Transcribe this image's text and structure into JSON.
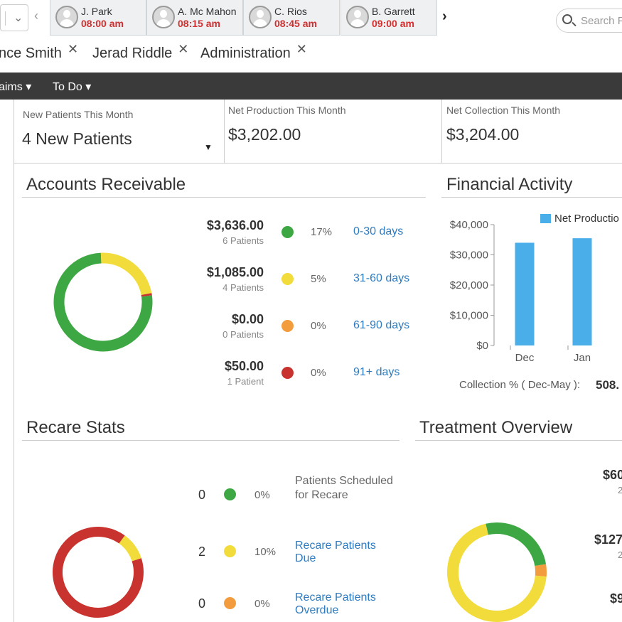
{
  "appointments": [
    {
      "name": "J. Park",
      "time": "08:00 am"
    },
    {
      "name": "A. Mc Mahon",
      "time": "08:15 am"
    },
    {
      "name": "C. Rios",
      "time": "08:45 am"
    },
    {
      "name": "B. Garrett",
      "time": "09:00 am"
    }
  ],
  "search": {
    "placeholder": "Search P"
  },
  "tabs": [
    {
      "label": "nce Smith"
    },
    {
      "label": "Jerad Riddle"
    },
    {
      "label": "Administration"
    }
  ],
  "menu": {
    "claims": "aims",
    "todo": "To Do"
  },
  "stats": [
    {
      "label": "New Patients This Month",
      "value": "4 New Patients"
    },
    {
      "label": "Net Production This Month",
      "value": "$3,202.00"
    },
    {
      "label": "Net Collection This Month",
      "value": "$3,204.00"
    }
  ],
  "accounts_receivable": {
    "title": "Accounts Receivable",
    "rows": [
      {
        "amount": "$3,636.00",
        "patients": "6 Patients",
        "percent": "17%",
        "range": "0-30 days",
        "color": "#3da843"
      },
      {
        "amount": "$1,085.00",
        "patients": "4 Patients",
        "percent": "5%",
        "range": "31-60 days",
        "color": "#f1dc3c"
      },
      {
        "amount": "$0.00",
        "patients": "0 Patients",
        "percent": "0%",
        "range": "61-90 days",
        "color": "#f39c3e"
      },
      {
        "amount": "$50.00",
        "patients": "1 Patient",
        "percent": "0%",
        "range": "91+ days",
        "color": "#c8332f"
      }
    ],
    "donut_fractions": [
      0.765,
      0.228,
      0.0,
      0.007
    ]
  },
  "financial_activity": {
    "title": "Financial Activity",
    "collection_label": "Collection % ( Dec-May ):",
    "collection_value": "508."
  },
  "chart_data": {
    "type": "bar",
    "categories": [
      "Dec",
      "Jan"
    ],
    "series": [
      {
        "name": "Net Productio",
        "values": [
          34000,
          35500
        ],
        "color": "#4aaee8"
      }
    ],
    "ylim": [
      0,
      40000
    ],
    "yticks": [
      "$0",
      "$10,000",
      "$20,000",
      "$30,000",
      "$40,000"
    ],
    "ytick_values": [
      0,
      10000,
      20000,
      30000,
      40000
    ],
    "legend": "top-right"
  },
  "recare": {
    "title": "Recare Stats",
    "rows": [
      {
        "count": "0",
        "percent": "0%",
        "label": "Patients Scheduled for Recare",
        "link": false,
        "color": "#3da843"
      },
      {
        "count": "2",
        "percent": "10%",
        "label": "Recare Patients Due",
        "link": true,
        "color": "#f1dc3c"
      },
      {
        "count": "0",
        "percent": "0%",
        "label": "Recare Patients Overdue",
        "link": true,
        "color": "#f39c3e"
      }
    ],
    "donut_fractions": [
      0.0,
      0.1,
      0.0,
      0.9
    ]
  },
  "treatment": {
    "title": "Treatment Overview",
    "amounts": [
      {
        "amount": "$60",
        "sub": "2"
      },
      {
        "amount": "$127",
        "sub": "2"
      },
      {
        "amount": "$9",
        "sub": ""
      }
    ],
    "donut_fractions": [
      0.26,
      0.04,
      0.7
    ],
    "colors": [
      "#3da843",
      "#f39c3e",
      "#f1dc3c"
    ]
  }
}
